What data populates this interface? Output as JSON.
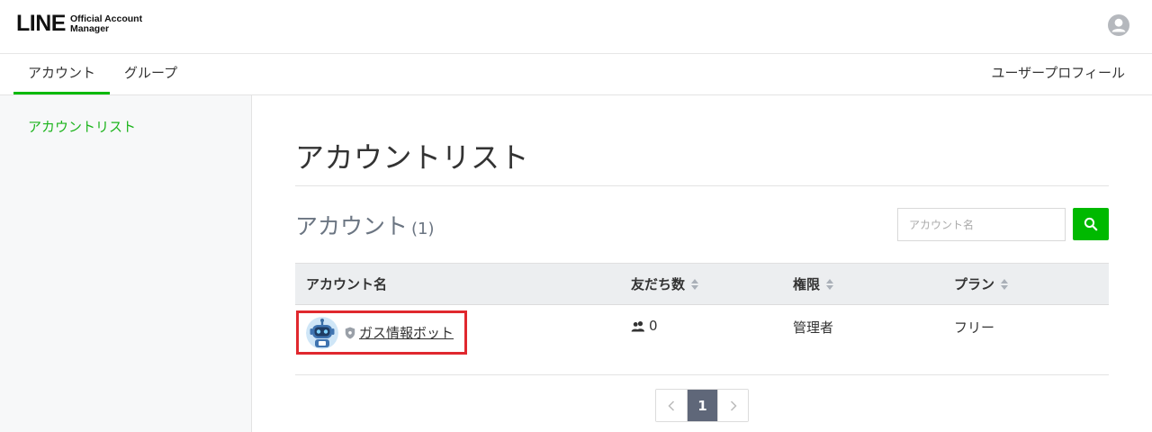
{
  "header": {
    "logo_main": "LINE",
    "logo_sub_line1": "Official Account",
    "logo_sub_line2": "Manager",
    "avatar_icon": "user-avatar-icon"
  },
  "nav": {
    "tabs": [
      {
        "label": "アカウント",
        "active": true
      },
      {
        "label": "グループ",
        "active": false
      }
    ],
    "right_link": "ユーザープロフィール"
  },
  "sidebar": {
    "items": [
      {
        "label": "アカウントリスト",
        "active": true
      }
    ]
  },
  "main": {
    "title": "アカウントリスト",
    "section_title": "アカウント",
    "section_count": "(1)",
    "search": {
      "placeholder": "アカウント名",
      "value": ""
    },
    "table": {
      "columns": [
        {
          "label": "アカウント名",
          "sortable": false
        },
        {
          "label": "友だち数",
          "sortable": true
        },
        {
          "label": "権限",
          "sortable": true
        },
        {
          "label": "プラン",
          "sortable": true
        }
      ],
      "rows": [
        {
          "name": "ガス情報ボット",
          "friends": "0",
          "role": "管理者",
          "plan": "フリー"
        }
      ]
    },
    "pagination": {
      "prev": "‹",
      "current": "1",
      "next": "›"
    }
  },
  "colors": {
    "accent": "#00b900",
    "highlight_border": "#e0282e",
    "pager_current": "#5f6779"
  }
}
